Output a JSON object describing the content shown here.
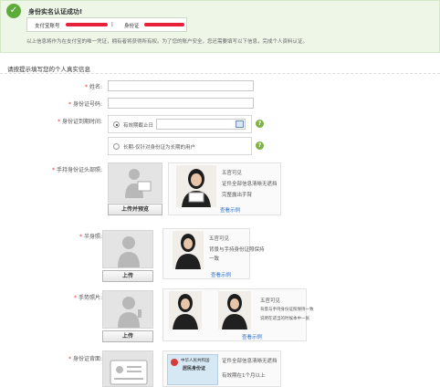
{
  "banner": {
    "title": "身份实名认证成功!",
    "account_label": "支付宝账号",
    "separator": "|",
    "id_label": "身份证",
    "note": "以上信息将作为在支付宝的唯一凭证，拥有者将获得所有权。为了您的账户安全，您还需要填写以下信息，完成个人资料认证。"
  },
  "form": {
    "section_title": "请按提示填写您的个人真实信息",
    "name_label": "姓名:",
    "id_number_label": "身份证号码:",
    "validity_label": "身份证到期时间:",
    "option_date": "有效期截止日",
    "option_longterm": "长期-仅针对身份证为长期的用户",
    "handheld_label": "手持身份证头部照:",
    "upload_preview_button": "上传并预览",
    "handheld_tips": [
      "五官可见",
      "证件全部信息清晰无遮挡",
      "完整露出手臂"
    ],
    "view_example": "查看示例",
    "bust_label": "半身照:",
    "upload_button": "上传",
    "bust_tips": [
      "五官可见",
      "背景与手持身份证照保持",
      "一致"
    ],
    "gesture_label": "手势照片:",
    "gesture_tips": [
      "五官可见",
      "背景与手持身份证照保持一致",
      "说明在适当的时候本中一张"
    ],
    "id_back_label": "身份证背面:",
    "id_back_tips": [
      "证件全部信息清晰无遮挡",
      "有效期在1个月以上"
    ],
    "id_card_text": [
      "中华人民共和国",
      "居民身份证"
    ]
  },
  "colors": {
    "success_green": "#5cac3a",
    "redaction": "#e8203a",
    "link": "#2d6cc0"
  }
}
